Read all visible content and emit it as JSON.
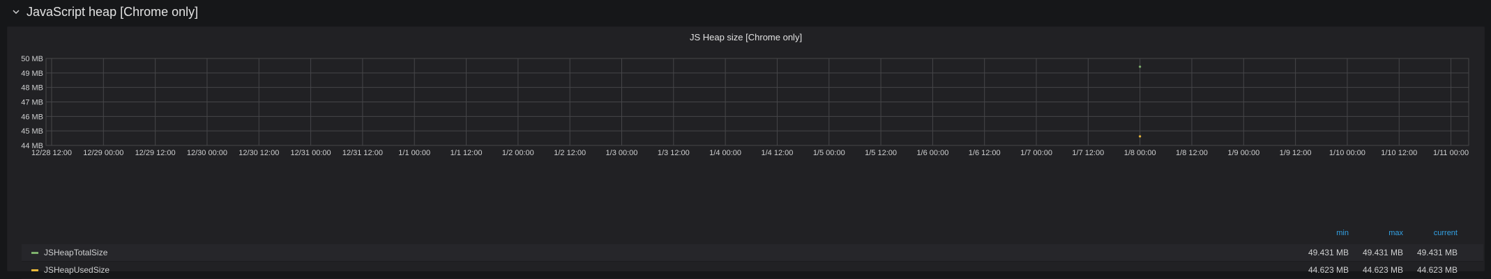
{
  "row": {
    "title": "JavaScript heap [Chrome only]",
    "chevron_icon": "chevron-down-icon"
  },
  "panel": {
    "title": "JS Heap size [Chrome only]"
  },
  "colors": {
    "JSHeapTotalSize": "#7eb26d",
    "JSHeapUsedSize": "#eab839",
    "legend_header": "#33a2e5",
    "grid": "#464649"
  },
  "legend": {
    "headers": {
      "min": "min",
      "max": "max",
      "current": "current"
    },
    "items": [
      {
        "name": "JSHeapTotalSize",
        "min": "49.431 MB",
        "max": "49.431 MB",
        "current": "49.431 MB"
      },
      {
        "name": "JSHeapUsedSize",
        "min": "44.623 MB",
        "max": "44.623 MB",
        "current": "44.623 MB"
      }
    ]
  },
  "chart_data": {
    "type": "scatter",
    "title": "JS Heap size [Chrome only]",
    "xlabel": "",
    "ylabel": "",
    "x_tick_labels": [
      "12/28 12:00",
      "12/29 00:00",
      "12/29 12:00",
      "12/30 00:00",
      "12/30 12:00",
      "12/31 00:00",
      "12/31 12:00",
      "1/1 00:00",
      "1/1 12:00",
      "1/2 00:00",
      "1/2 12:00",
      "1/3 00:00",
      "1/3 12:00",
      "1/4 00:00",
      "1/4 12:00",
      "1/5 00:00",
      "1/5 12:00",
      "1/6 00:00",
      "1/6 12:00",
      "1/7 00:00",
      "1/7 12:00",
      "1/8 00:00",
      "1/8 12:00",
      "1/9 00:00",
      "1/9 12:00",
      "1/10 00:00",
      "1/10 12:00",
      "1/11 00:00"
    ],
    "y_tick_labels": [
      "44 MB",
      "45 MB",
      "46 MB",
      "47 MB",
      "48 MB",
      "49 MB",
      "50 MB"
    ],
    "ylim": [
      44,
      50
    ],
    "grid": true,
    "series": [
      {
        "name": "JSHeapTotalSize",
        "points": [
          {
            "x": "1/8 00:00",
            "y": 49.431
          }
        ]
      },
      {
        "name": "JSHeapUsedSize",
        "points": [
          {
            "x": "1/8 00:00",
            "y": 44.623
          }
        ]
      }
    ]
  }
}
